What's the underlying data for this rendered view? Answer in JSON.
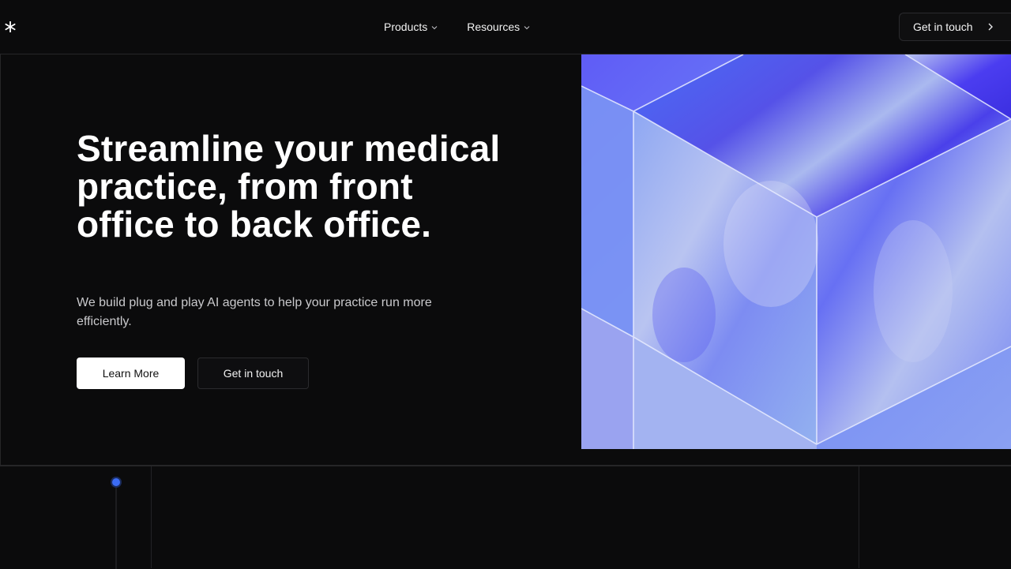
{
  "nav": {
    "logo_glyph": "*",
    "menu": [
      {
        "label": "Products"
      },
      {
        "label": "Resources"
      }
    ],
    "cta_label": "Get in touch"
  },
  "hero": {
    "title": "Streamline your medical practice, from front office to back office.",
    "subtitle": "We build plug and play AI agents to help your practice run more efficiently.",
    "primary_button": "Learn More",
    "secondary_button": "Get in touch"
  },
  "colors": {
    "background": "#0b0b0c",
    "accent_blue": "#3b6cf5",
    "art_violet": "#5a5cf2"
  },
  "icons": {
    "logo": "asterisk-icon",
    "dropdown": "chevron-down-icon",
    "cta": "chevron-right-icon",
    "timeline": "timeline-dot-icon"
  }
}
